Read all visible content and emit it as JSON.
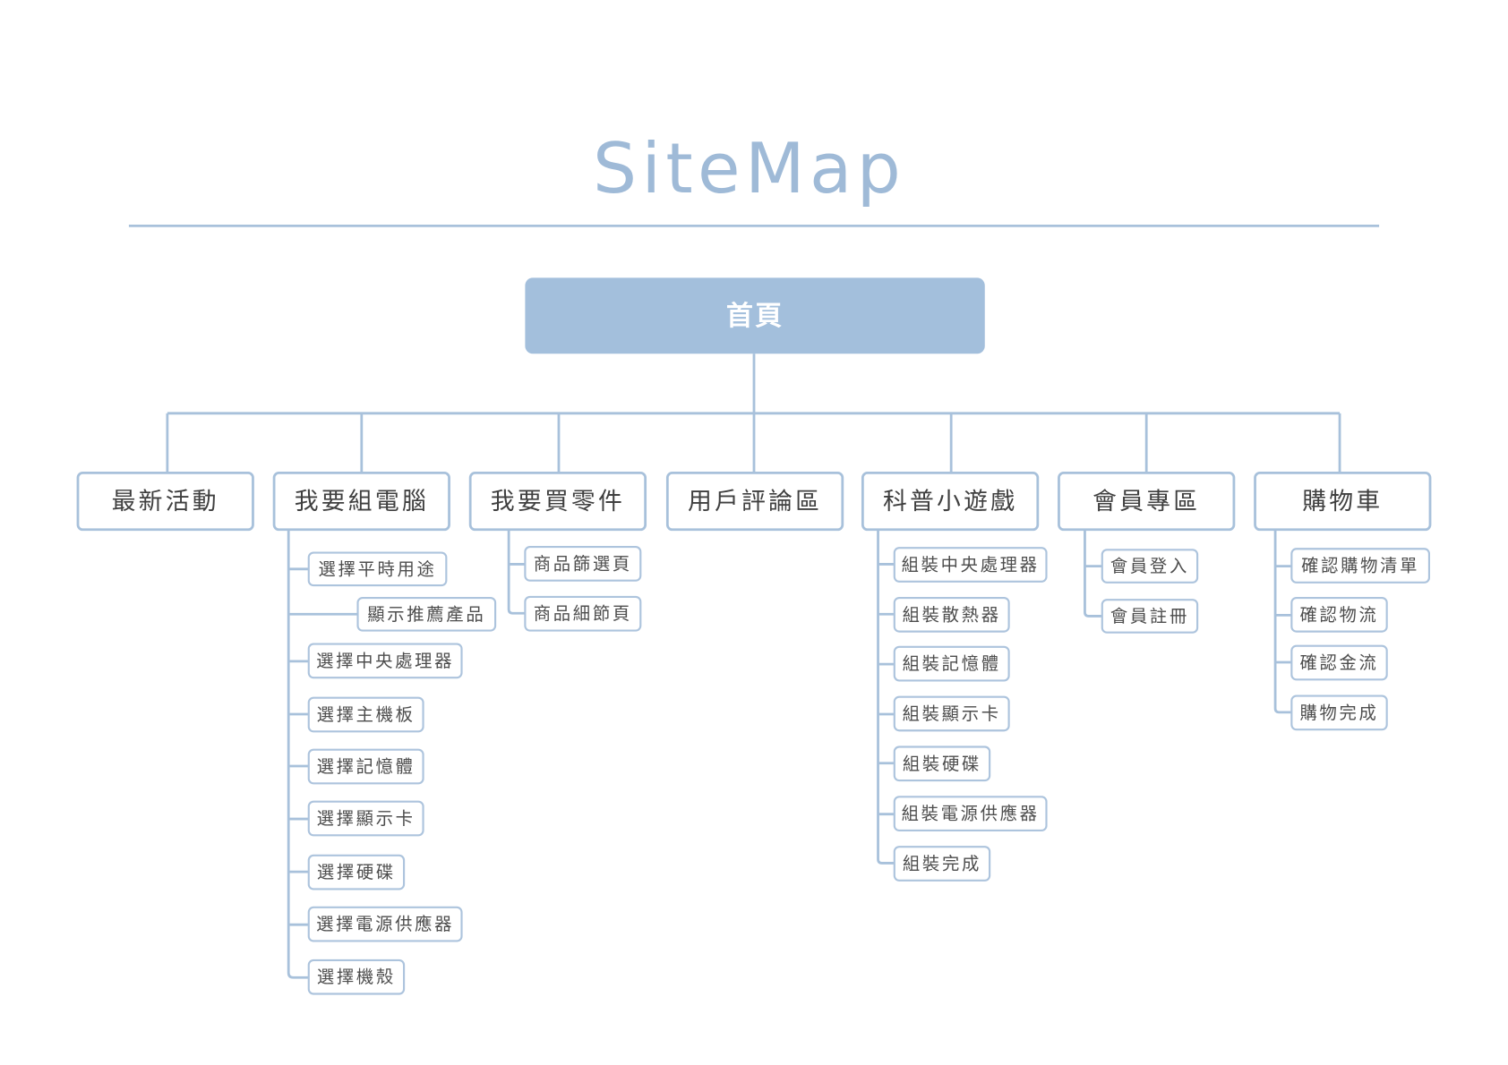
{
  "title": "SiteMap",
  "root": {
    "label": "首頁"
  },
  "sections": [
    {
      "label": "最新活動",
      "children": []
    },
    {
      "label": "我要組電腦",
      "children": [
        "選擇平時用途",
        "顯示推薦產品",
        "選擇中央處理器",
        "選擇主機板",
        "選擇記憶體",
        "選擇顯示卡",
        "選擇硬碟",
        "選擇電源供應器",
        "選擇機殼"
      ]
    },
    {
      "label": "我要買零件",
      "children": [
        "商品篩選頁",
        "商品細節頁"
      ]
    },
    {
      "label": "用戶評論區",
      "children": []
    },
    {
      "label": "科普小遊戲",
      "children": [
        "組裝中央處理器",
        "組裝散熱器",
        "組裝記憶體",
        "組裝顯示卡",
        "組裝硬碟",
        "組裝電源供應器",
        "組裝完成"
      ]
    },
    {
      "label": "會員專區",
      "children": [
        "會員登入",
        "會員註冊"
      ]
    },
    {
      "label": "購物車",
      "children": [
        "確認購物清單",
        "確認物流",
        "確認金流",
        "購物完成"
      ]
    }
  ],
  "colors": {
    "accent": "#a3bfdc",
    "line": "#a8c1db",
    "title": "#9fbad7",
    "text": "#3f3f3f",
    "background": "#ffffff"
  }
}
